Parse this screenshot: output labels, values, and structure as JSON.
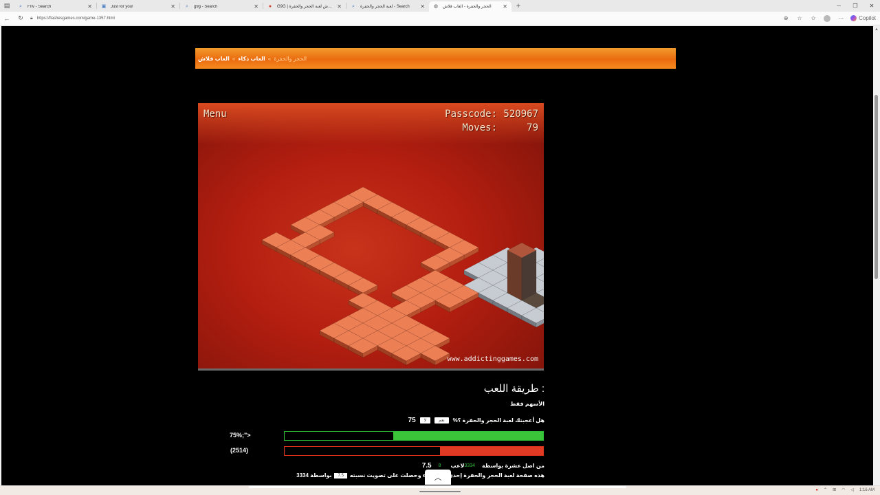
{
  "browser": {
    "tabs": [
      {
        "title": "Friv - Search",
        "icon": "search-icon",
        "glyph": "⌕",
        "active": false
      },
      {
        "title": "Just for you!",
        "icon": "site-icon",
        "glyph": "▣",
        "active": false
      },
      {
        "title": "g9g - Search",
        "icon": "search-icon",
        "glyph": "⌕",
        "active": false
      },
      {
        "title": "G9G | العاب فلاش لعبة الحجر والحفرة",
        "icon": "g9g-icon",
        "glyph": "●",
        "active": false
      },
      {
        "title": "لعبة الحجر والحفرة - Search",
        "icon": "search-icon",
        "glyph": "⌕",
        "active": false
      },
      {
        "title": "الحجر والحفرة - العاب فلاش",
        "icon": "globe-icon",
        "glyph": "◍",
        "active": true
      }
    ],
    "new_tab_glyph": "+",
    "url": "https://flashesgames.com/game-1357.html",
    "copilot_label": "Copilot"
  },
  "banner": {
    "crumbs": [
      "العاب فلاش",
      "العاب ذكاء",
      "الحجر والحفرة"
    ],
    "separator": "»"
  },
  "game": {
    "menu_label": "Menu",
    "passcode_label": "Passcode:",
    "passcode_value": "520967",
    "moves_label": "Moves:",
    "moves_value": "79",
    "site_credit": "www.addictinggames.com"
  },
  "howto": {
    "title": ": طريقة اللعب",
    "text": "الأسهم فقط"
  },
  "rating": {
    "question": "هل أعجبتك لعبة الحجر والحفرة ؟%",
    "yes_button": "نعم",
    "no_button": "لا",
    "percent": "75",
    "yes_label": "75%;\">",
    "no_label": "(2514)",
    "yes_fraction": 0.58,
    "no_fraction": 0.4,
    "score_prefix": "من اصل عشرة بواسطة",
    "votes": "3334",
    "players_label": "لاعب",
    "players_count": "8",
    "score": "7.5",
    "summary_text": "هذه صفحة لعبة الحجر والحفرة إحدى الـ",
    "summary_mid": "ب ذكاء وحصلت على تصويت نسبته",
    "summary_score": "7.5",
    "summary_suffix": "بواسطة 3334"
  },
  "tray": {
    "time": "1:16 AM"
  },
  "colors": {
    "banner": "#ea6b0e",
    "yes_bar": "#3bc43a",
    "no_bar": "#e03a24",
    "game_bg": "#b31e10"
  }
}
